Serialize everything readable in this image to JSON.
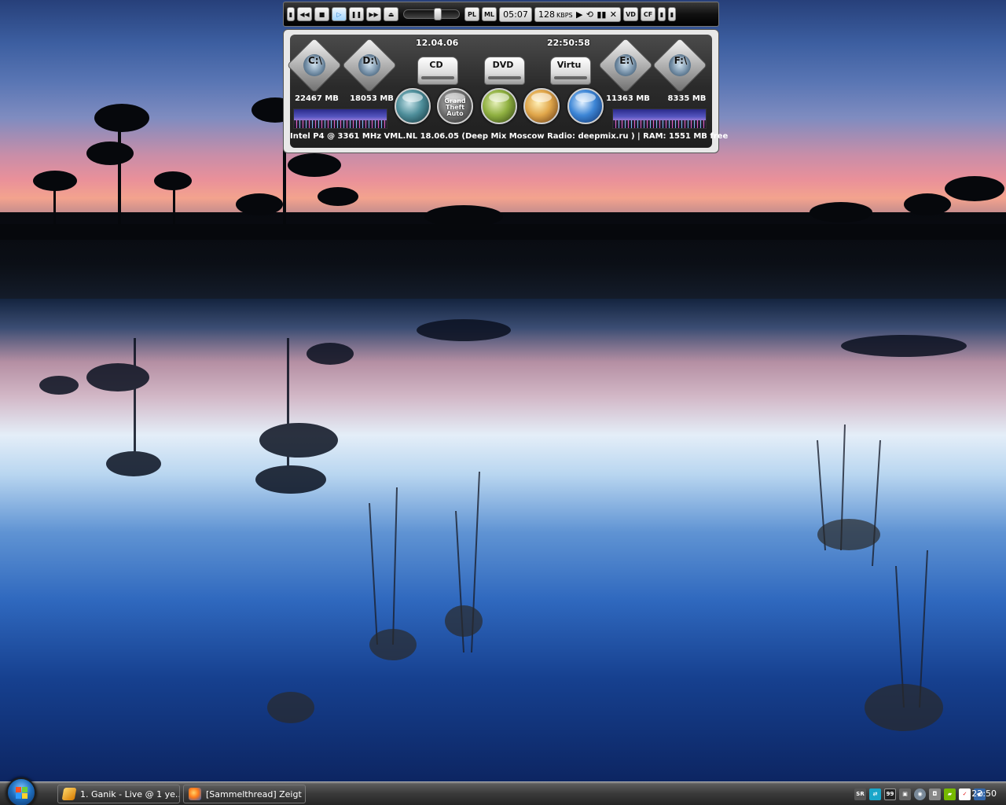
{
  "player": {
    "buttons": {
      "pl": "PL",
      "ml": "ML",
      "vd": "VD",
      "cf": "CF"
    },
    "time": "05:07",
    "bitrate": "128",
    "bitrate_unit": "KBPS"
  },
  "panel": {
    "date": "12.04.06",
    "clock": "22:50:58",
    "drives": [
      {
        "label": "C:\\",
        "kind": "hdd",
        "free": "22467 MB"
      },
      {
        "label": "D:\\",
        "kind": "hdd",
        "free": "18053 MB"
      },
      {
        "label": "CD",
        "kind": "optical"
      },
      {
        "label": "DVD",
        "kind": "optical"
      },
      {
        "label": "Virtu",
        "kind": "optical"
      },
      {
        "label": "E:\\",
        "kind": "hdd",
        "free": "11363 MB"
      },
      {
        "label": "F:\\",
        "kind": "hdd",
        "free": "8335 MB"
      }
    ],
    "shortcut_icons": [
      "steam-orb-icon",
      "gta-orb-icon",
      "half-life-orb-icon",
      "face-orb-icon",
      "vista-orb-icon"
    ],
    "gta_text": "Grand Theft Auto",
    "status_line": "Intel P4 @ 3361 MHz  VML.NL 18.06.05 (Deep Mix Moscow Radio:  deepmix.ru ) |  RAM: 1551 MB free"
  },
  "taskbar": {
    "tasks": [
      {
        "label": "1. Ganik - Live @ 1 ye...",
        "icon": "winamp-icon"
      },
      {
        "label": "[Sammelthread] Zeigt ...",
        "icon": "firefox-icon"
      }
    ],
    "tray_icons": [
      "sr-icon",
      "network-icon",
      "cpu-meter-icon",
      "security-icon",
      "steam-icon",
      "camera-icon",
      "nvidia-icon",
      "antivir-icon",
      "volume-icon"
    ],
    "tray_text": {
      "sr": "SR",
      "cpu": "99"
    },
    "clock": "22:50"
  },
  "colors": {
    "taskbar": "#2f2f2f",
    "panel_bg": "#2b2b2b",
    "player_accent": "#1a74c9"
  }
}
